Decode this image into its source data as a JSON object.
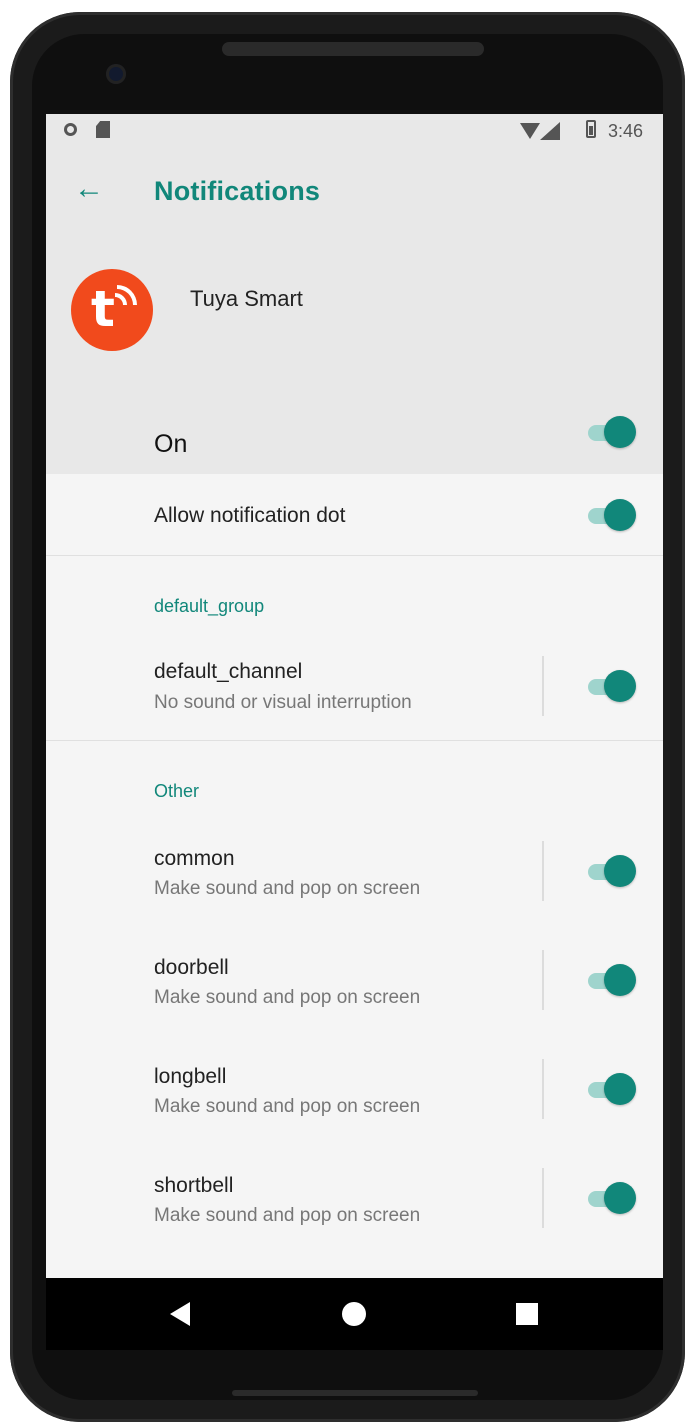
{
  "statusbar": {
    "time": "3:46"
  },
  "header": {
    "title": "Notifications",
    "app_name": "Tuya Smart",
    "master_label": "On"
  },
  "settings": {
    "notification_dot_label": "Allow notification dot"
  },
  "groups": [
    {
      "name": "default_group",
      "channels": [
        {
          "name": "default_channel",
          "description": "No sound or visual interruption",
          "enabled": true
        }
      ]
    },
    {
      "name": "Other",
      "channels": [
        {
          "name": "common",
          "description": "Make sound and pop on screen",
          "enabled": true
        },
        {
          "name": "doorbell",
          "description": "Make sound and pop on screen",
          "enabled": true
        },
        {
          "name": "longbell",
          "description": "Make sound and pop on screen",
          "enabled": true
        },
        {
          "name": "shortbell",
          "description": "Make sound and pop on screen",
          "enabled": true
        }
      ]
    }
  ],
  "colors": {
    "accent": "#11877a",
    "accent_track": "#9fd4cd",
    "app_icon": "#f14a1c",
    "header_bg": "#e8e8e8",
    "screen_bg": "#f5f5f5"
  },
  "icons": [
    "back-arrow-icon",
    "tuya-app-icon",
    "wifi-icon",
    "signal-icon",
    "battery-icon",
    "nav-back-icon",
    "nav-home-icon",
    "nav-recents-icon"
  ]
}
